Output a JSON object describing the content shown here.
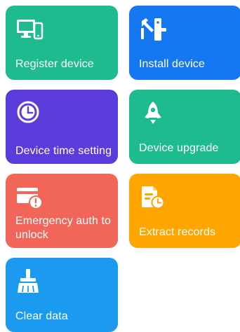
{
  "tiles": [
    {
      "label": "Register device",
      "icon": "devices-icon",
      "color": "#1DBB8D"
    },
    {
      "label": "Install device",
      "icon": "install-lock-icon",
      "color": "#1677F2"
    },
    {
      "label": "Device time setting",
      "icon": "clock-icon",
      "color": "#5A3CDB"
    },
    {
      "label": "Device upgrade",
      "icon": "rocket-icon",
      "color": "#1DBB8D"
    },
    {
      "label": "Emergency auth to unlock",
      "icon": "emergency-card-icon",
      "color": "#F2665A"
    },
    {
      "label": "Extract records",
      "icon": "records-icon",
      "color": "#FFA500"
    },
    {
      "label": "Clear data",
      "icon": "broom-icon",
      "color": "#1A9BF0"
    }
  ]
}
